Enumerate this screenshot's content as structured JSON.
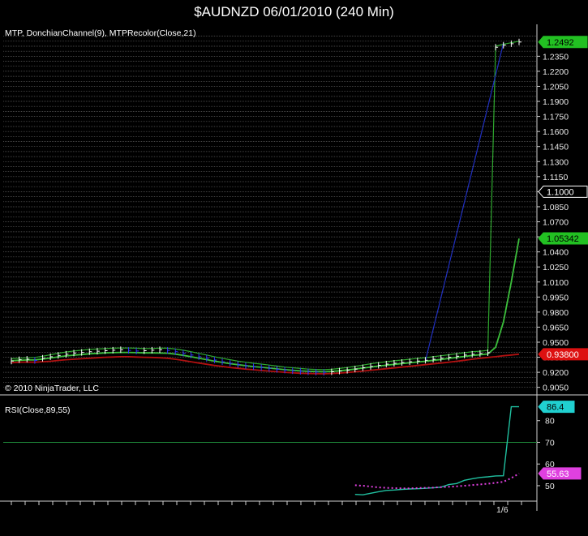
{
  "window": {
    "title": "$AUDNZD  06/01/2010 (240 Min)"
  },
  "price_panel": {
    "label": "MTP, DonchianChannel(9), MTPRecolor(Close,21)",
    "copyright": "© 2010 NinjaTrader, LLC"
  },
  "rsi_panel": {
    "label": "RSI(Close,89,55)"
  },
  "x_axis": {
    "date_label": "1/6"
  },
  "colors": {
    "background": "#000000",
    "grid": "#5a5a5a",
    "close_up": "#ffffff",
    "close_down": "#3333ff",
    "donchian_upper": "#2ea82e",
    "donchian_lower": "#b01010",
    "donchian_mid": "#3cbf3c",
    "jump_line": "#2030c0",
    "rsi_line": "#20c0a0",
    "rsi_avg": "#e040e0",
    "rsi_level": "#1f8a3a"
  },
  "chart_data": [
    {
      "type": "line",
      "name": "price",
      "ylim": [
        0.9015,
        1.2555
      ],
      "y_ticks": [
        0.905,
        0.92,
        0.935,
        0.95,
        0.965,
        0.98,
        0.995,
        1.01,
        1.025,
        1.04,
        1.055,
        1.07,
        1.085,
        1.1,
        1.115,
        1.13,
        1.145,
        1.16,
        1.175,
        1.19,
        1.205,
        1.22,
        1.235,
        1.2492
      ],
      "y_tick_labels": [
        "0.9050",
        "0.9200",
        "0.9350",
        "0.9500",
        "0.9650",
        "0.9800",
        "0.9950",
        "1.0100",
        "1.0250",
        "1.0400",
        "1.0550",
        "1.0700",
        "1.0850",
        "1.1000",
        "1.1150",
        "1.1300",
        "1.1450",
        "1.1600",
        "1.1750",
        "1.1900",
        "1.2050",
        "1.2200",
        "1.2350"
      ],
      "markers": [
        {
          "value": "1.2492",
          "y": 1.2492,
          "color": "#22c022",
          "text_color": "#000000"
        },
        {
          "value": "1.05342",
          "y": 1.05342,
          "color": "#22c022",
          "text_color": "#000000"
        },
        {
          "value": "0.93800",
          "y": 0.938,
          "color": "#dd1111",
          "text_color": "#ffffff"
        },
        {
          "value": "1.1000",
          "y": 1.1,
          "color": "#000000",
          "text_color": "#ffffff",
          "outlined": true
        }
      ],
      "close": [
        0.9312,
        0.9325,
        0.933,
        0.9318,
        0.934,
        0.9355,
        0.9368,
        0.938,
        0.9392,
        0.9398,
        0.9405,
        0.941,
        0.9415,
        0.942,
        0.9425,
        0.9418,
        0.9412,
        0.9415,
        0.942,
        0.9425,
        0.9418,
        0.9405,
        0.939,
        0.9372,
        0.9355,
        0.934,
        0.9322,
        0.9305,
        0.929,
        0.9278,
        0.9265,
        0.9255,
        0.9248,
        0.924,
        0.923,
        0.9222,
        0.9215,
        0.921,
        0.9205,
        0.9202,
        0.92,
        0.9205,
        0.9212,
        0.922,
        0.9232,
        0.9245,
        0.9258,
        0.927,
        0.9282,
        0.929,
        0.9298,
        0.9305,
        0.9312,
        0.932,
        0.933,
        0.934,
        0.935,
        0.936,
        0.9372,
        0.938,
        0.9388,
        0.9395,
        1.244,
        1.246,
        1.2475,
        1.2492
      ],
      "donchian_upper": [
        0.9335,
        0.934,
        0.9345,
        0.9348,
        0.936,
        0.9375,
        0.939,
        0.9402,
        0.9412,
        0.942,
        0.9428,
        0.9432,
        0.9436,
        0.944,
        0.9442,
        0.9442,
        0.944,
        0.9436,
        0.9438,
        0.944,
        0.944,
        0.9432,
        0.942,
        0.9405,
        0.9388,
        0.9372,
        0.9355,
        0.934,
        0.9325,
        0.9312,
        0.93,
        0.929,
        0.9282,
        0.9272,
        0.9262,
        0.9252,
        0.9245,
        0.9238,
        0.9232,
        0.9228,
        0.9226,
        0.923,
        0.9238,
        0.9248,
        0.926,
        0.9272,
        0.9285,
        0.9296,
        0.9305,
        0.9315,
        0.9322,
        0.933,
        0.9338,
        0.9345,
        0.9355,
        0.9365,
        0.9375,
        0.9385,
        0.9395,
        0.9405,
        0.941,
        0.9418,
        1.245,
        1.247,
        1.2485,
        1.25
      ],
      "donchian_lower": [
        0.9295,
        0.93,
        0.9302,
        0.93,
        0.9305,
        0.931,
        0.9318,
        0.9325,
        0.933,
        0.9335,
        0.934,
        0.9345,
        0.935,
        0.9352,
        0.9355,
        0.9355,
        0.9352,
        0.935,
        0.9348,
        0.9345,
        0.934,
        0.933,
        0.9318,
        0.9305,
        0.9292,
        0.928,
        0.9268,
        0.9258,
        0.9248,
        0.924,
        0.9232,
        0.9225,
        0.9218,
        0.9212,
        0.9206,
        0.92,
        0.9195,
        0.919,
        0.9188,
        0.9186,
        0.9185,
        0.9188,
        0.9192,
        0.9198,
        0.9205,
        0.9212,
        0.922,
        0.9228,
        0.9236,
        0.9244,
        0.9252,
        0.926,
        0.9268,
        0.9276,
        0.9284,
        0.9292,
        0.93,
        0.931,
        0.932,
        0.933,
        0.934,
        0.9348,
        0.9355,
        0.9365,
        0.9372,
        0.938
      ],
      "donchian_mid": [
        0.9315,
        0.932,
        0.9323,
        0.9324,
        0.9332,
        0.9342,
        0.9354,
        0.9363,
        0.9371,
        0.9377,
        0.9384,
        0.9388,
        0.9393,
        0.9396,
        0.9398,
        0.9398,
        0.9396,
        0.9393,
        0.9393,
        0.9392,
        0.939,
        0.9381,
        0.9369,
        0.9355,
        0.934,
        0.9326,
        0.9311,
        0.9299,
        0.9286,
        0.9276,
        0.9266,
        0.9257,
        0.925,
        0.9242,
        0.9234,
        0.9226,
        0.922,
        0.9214,
        0.921,
        0.9207,
        0.9205,
        0.9209,
        0.9215,
        0.9223,
        0.9232,
        0.9242,
        0.9252,
        0.9262,
        0.927,
        0.9279,
        0.9287,
        0.9295,
        0.9303,
        0.931,
        0.932,
        0.9328,
        0.9338,
        0.9348,
        0.9358,
        0.9368,
        0.9375,
        0.9383,
        0.945,
        0.97,
        1.01,
        1.0534
      ]
    },
    {
      "type": "line",
      "name": "rsi",
      "ylim": [
        44,
        90
      ],
      "y_ticks": [
        50,
        60,
        70,
        80
      ],
      "level": 70,
      "markers": [
        {
          "value": "86.4",
          "y": 86.4,
          "color": "#20d0d0",
          "text_color": "#000000"
        },
        {
          "value": "55.63",
          "y": 55.63,
          "color": "#e040e0",
          "text_color": "#ffffff"
        }
      ],
      "rsi_start_index": 44,
      "rsi": [
        46.0,
        45.8,
        46.5,
        47.2,
        47.8,
        48.0,
        48.3,
        48.5,
        48.6,
        48.8,
        49.0,
        49.3,
        50.5,
        51.0,
        52.5,
        53.2,
        53.8,
        54.1,
        54.5,
        54.6,
        86.4,
        86.4
      ],
      "rsi_avg": [
        50.2,
        50.0,
        49.6,
        49.2,
        49.0,
        48.9,
        48.8,
        48.8,
        48.9,
        49.0,
        49.1,
        49.3,
        49.5,
        49.7,
        50.0,
        50.3,
        50.6,
        50.9,
        51.3,
        51.8,
        53.5,
        55.63
      ]
    }
  ]
}
